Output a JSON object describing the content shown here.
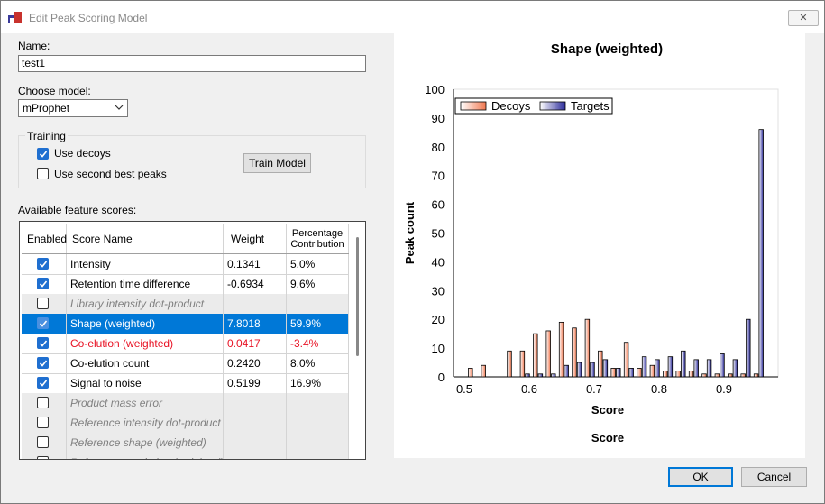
{
  "window": {
    "title": "Edit Peak Scoring Model",
    "close_label": "✕"
  },
  "form": {
    "name_label": "Name:",
    "name_value": "test1",
    "model_label": "Choose model:",
    "model_value": "mProphet"
  },
  "training": {
    "group_label": "Training",
    "use_decoys_label": "Use decoys",
    "use_decoys_checked": true,
    "second_best_label": "Use second best peaks",
    "second_best_checked": false,
    "train_button": "Train Model"
  },
  "features": {
    "label": "Available feature scores:",
    "headers": {
      "enabled": "Enabled",
      "name": "Score Name",
      "weight": "Weight",
      "contribution_line1": "Percentage",
      "contribution_line2": "Contribution"
    },
    "rows": [
      {
        "enabled": true,
        "name": "Intensity",
        "weight": "0.1341",
        "contribution": "5.0%",
        "state": "normal"
      },
      {
        "enabled": true,
        "name": "Retention time difference",
        "weight": "-0.6934",
        "contribution": "9.6%",
        "state": "normal"
      },
      {
        "enabled": false,
        "name": "Library intensity dot-product",
        "weight": "",
        "contribution": "",
        "state": "disabled"
      },
      {
        "enabled": true,
        "name": "Shape (weighted)",
        "weight": "7.8018",
        "contribution": "59.9%",
        "state": "selected"
      },
      {
        "enabled": true,
        "name": "Co-elution (weighted)",
        "weight": "0.0417",
        "contribution": "-3.4%",
        "state": "red"
      },
      {
        "enabled": true,
        "name": "Co-elution count",
        "weight": "0.2420",
        "contribution": "8.0%",
        "state": "normal"
      },
      {
        "enabled": true,
        "name": "Signal to noise",
        "weight": "0.5199",
        "contribution": "16.9%",
        "state": "normal"
      },
      {
        "enabled": false,
        "name": "Product mass error",
        "weight": "",
        "contribution": "",
        "state": "disabled"
      },
      {
        "enabled": false,
        "name": "Reference intensity dot-product",
        "weight": "",
        "contribution": "",
        "state": "disabled"
      },
      {
        "enabled": false,
        "name": "Reference shape (weighted)",
        "weight": "",
        "contribution": "",
        "state": "disabled"
      },
      {
        "enabled": false,
        "name": "Reference co-elution (weighted)",
        "weight": "",
        "contribution": "",
        "state": "disabled"
      }
    ]
  },
  "buttons": {
    "ok": "OK",
    "cancel": "Cancel"
  },
  "colors": {
    "decoys": "#f07850",
    "targets": "#2a2a9a",
    "selection": "#0078d7",
    "checkbox": "#1f6fd0",
    "error_text": "#e81123"
  },
  "chart_data": {
    "type": "bar",
    "title": "Shape (weighted)",
    "xlabel": "Score",
    "xlabel2": "Score",
    "ylabel": "Peak count",
    "ylim": [
      0,
      100
    ],
    "yticks": [
      0,
      10,
      20,
      30,
      40,
      50,
      60,
      70,
      80,
      90,
      100
    ],
    "xlim": [
      0.5,
      1.0
    ],
    "xticks": [
      0.5,
      0.6,
      0.7,
      0.8,
      0.9
    ],
    "legend": "top-left",
    "bin_width": 0.02,
    "series": [
      {
        "name": "Decoys",
        "color": "#f07850",
        "x": [
          0.53,
          0.55,
          0.57,
          0.59,
          0.61,
          0.63,
          0.65,
          0.67,
          0.69,
          0.71,
          0.73,
          0.75,
          0.77,
          0.79,
          0.81,
          0.83,
          0.85,
          0.87,
          0.89,
          0.91,
          0.93,
          0.95,
          0.97
        ],
        "values": [
          3,
          4,
          0,
          9,
          9,
          15,
          16,
          19,
          17,
          20,
          9,
          3,
          12,
          3,
          4,
          2,
          2,
          2,
          1,
          1,
          1,
          1,
          1
        ]
      },
      {
        "name": "Targets",
        "color": "#2a2a9a",
        "x": [
          0.53,
          0.55,
          0.57,
          0.59,
          0.61,
          0.63,
          0.65,
          0.67,
          0.69,
          0.71,
          0.73,
          0.75,
          0.77,
          0.79,
          0.81,
          0.83,
          0.85,
          0.87,
          0.89,
          0.91,
          0.93,
          0.95,
          0.97
        ],
        "values": [
          0,
          0,
          0,
          0,
          1,
          1,
          1,
          4,
          5,
          5,
          6,
          3,
          3,
          7,
          6,
          7,
          9,
          6,
          6,
          8,
          6,
          20,
          86
        ]
      }
    ]
  }
}
